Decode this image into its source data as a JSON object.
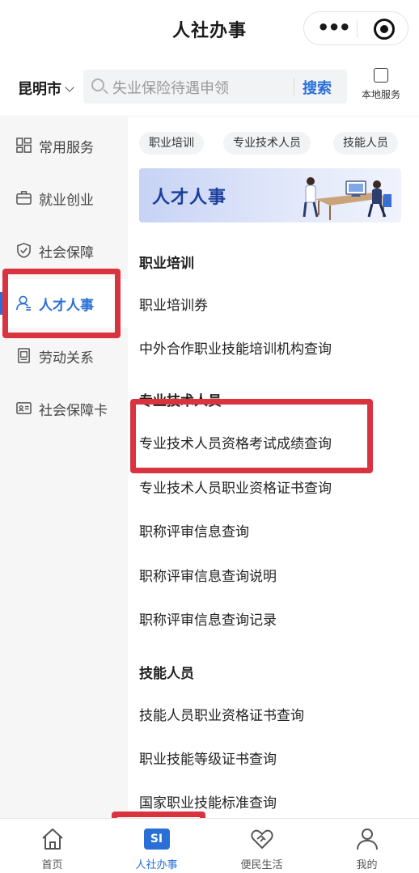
{
  "app": {
    "title": "人社办事",
    "capsule": {
      "more_icon": "more-dots-icon",
      "close_icon": "target-icon"
    }
  },
  "search": {
    "city": "昆明市",
    "placeholder": "失业保险待遇申领",
    "button": "搜索",
    "local_service": "本地服务"
  },
  "sidebar": {
    "items": [
      {
        "label": "常用服务",
        "icon": "grid-icon"
      },
      {
        "label": "就业创业",
        "icon": "briefcase-icon"
      },
      {
        "label": "社会保障",
        "icon": "shield-icon"
      },
      {
        "label": "人才人事",
        "icon": "person-icon",
        "active": true
      },
      {
        "label": "劳动关系",
        "icon": "contract-icon"
      },
      {
        "label": "社会保障卡",
        "icon": "id-card-icon"
      }
    ]
  },
  "main": {
    "chips": [
      "职业培训",
      "专业技术人员",
      "技能人员"
    ],
    "banner_title": "人才人事",
    "sections": [
      {
        "title": "职业培训",
        "items": [
          "职业培训券",
          "中外合作职业技能培训机构查询"
        ]
      },
      {
        "title": "专业技术人员",
        "items": [
          "专业技术人员资格考试成绩查询",
          "专业技术人员职业资格证书查询",
          "职称评审信息查询",
          "职称评审信息查询说明",
          "职称评审信息查询记录"
        ]
      },
      {
        "title": "技能人员",
        "items": [
          "技能人员职业资格证书查询",
          "职业技能等级证书查询",
          "国家职业技能标准查询"
        ]
      }
    ]
  },
  "tabbar": {
    "tabs": [
      {
        "label": "首页",
        "icon": "home-icon"
      },
      {
        "label": "人社办事",
        "icon": "si-badge-icon",
        "badge": "SI",
        "active": true
      },
      {
        "label": "便民生活",
        "icon": "heart-hands-icon"
      },
      {
        "label": "我的",
        "icon": "user-icon"
      }
    ]
  },
  "colors": {
    "accent": "#2a6fd6",
    "highlight": "#d9333f",
    "sidebar_bg": "#f6f6f6"
  }
}
